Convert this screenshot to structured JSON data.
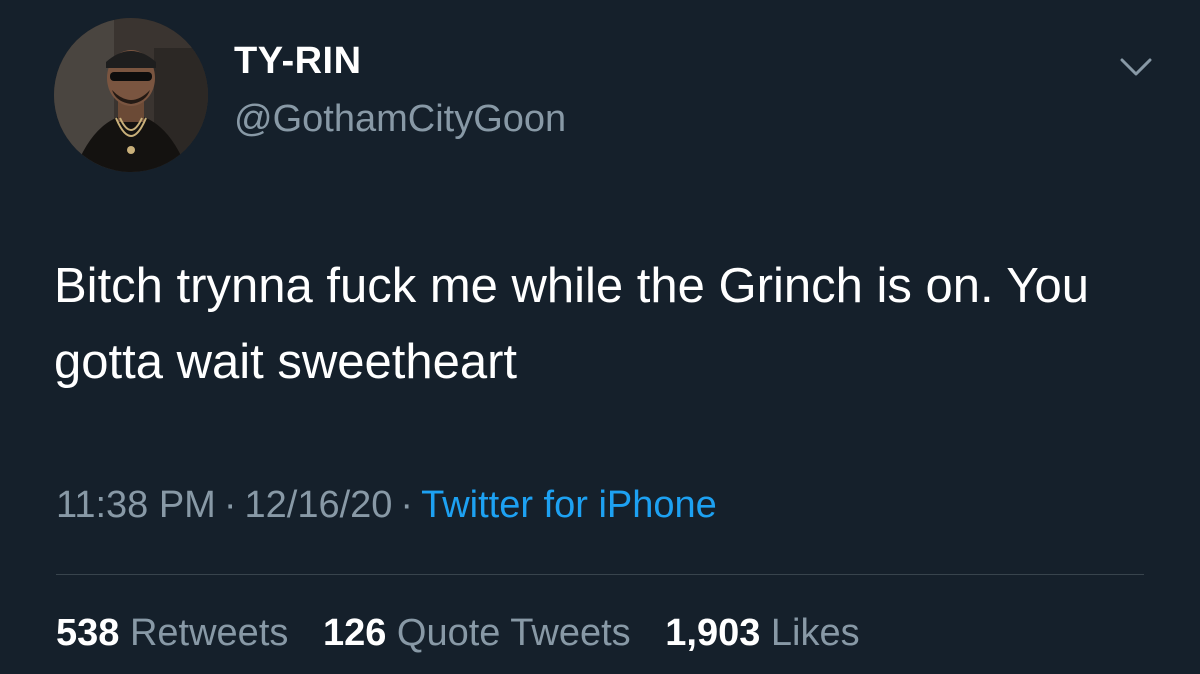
{
  "user": {
    "display_name": "TY-RIN",
    "handle": "@GothamCityGoon",
    "avatar_icon": "profile-photo"
  },
  "menu": {
    "caret_icon": "chevron-down-icon"
  },
  "tweet": {
    "text": "Bitch trynna fuck me while the Grinch is on. You gotta wait sweetheart",
    "time": "11:38 PM",
    "separator": "·",
    "date": "12/16/20",
    "source": "Twitter for iPhone"
  },
  "stats": {
    "retweets_count": "538",
    "retweets_label": "Retweets",
    "quotes_count": "126",
    "quotes_label": "Quote Tweets",
    "likes_count": "1,903",
    "likes_label": "Likes"
  },
  "colors": {
    "background": "#15202b",
    "text_primary": "#ffffff",
    "text_secondary": "#8899a6",
    "link": "#1da1f2",
    "divider": "#38444d"
  }
}
